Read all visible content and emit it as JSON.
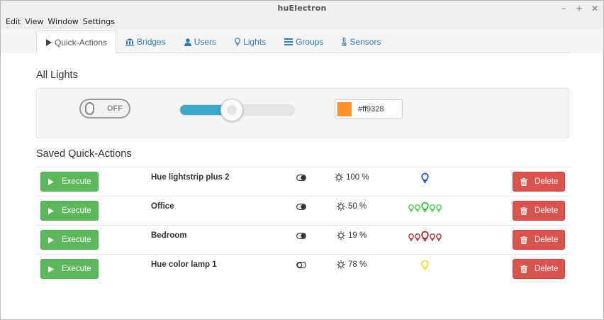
{
  "window": {
    "title": "huElectron",
    "controls": {
      "minimize": "–",
      "maximize": "+",
      "close": "✕"
    }
  },
  "menu": [
    "Edit",
    "View",
    "Window",
    "Settings"
  ],
  "tabs": [
    {
      "label": "Quick-Actions",
      "icon": "play-icon",
      "active": true
    },
    {
      "label": "Bridges",
      "icon": "bank-icon"
    },
    {
      "label": "Users",
      "icon": "user-icon"
    },
    {
      "label": "Lights",
      "icon": "lightbulb-icon"
    },
    {
      "label": "Groups",
      "icon": "list-icon"
    },
    {
      "label": "Sensors",
      "icon": "thermometer-icon"
    }
  ],
  "all_lights": {
    "title": "All Lights",
    "power_label": "OFF",
    "brightness_percent": 45,
    "color_hex": "#ff9328"
  },
  "saved": {
    "title": "Saved Quick-Actions",
    "execute_label": "Execute",
    "delete_label": "Delete",
    "rows": [
      {
        "name": "Hue lightstrip plus 2",
        "on": true,
        "brightness": "100 %",
        "bulb_color": "#1a4fd6",
        "bulb_count": 1
      },
      {
        "name": "Office",
        "on": true,
        "brightness": "50 %",
        "bulb_color": "#22cc22",
        "bulb_count": 5
      },
      {
        "name": "Bedroom",
        "on": true,
        "brightness": "19 %",
        "bulb_color": "#aa1111",
        "bulb_count": 5
      },
      {
        "name": "Hue color lamp 1",
        "on": false,
        "brightness": "78 %",
        "bulb_color": "#e8e81a",
        "bulb_count": 1
      }
    ]
  }
}
